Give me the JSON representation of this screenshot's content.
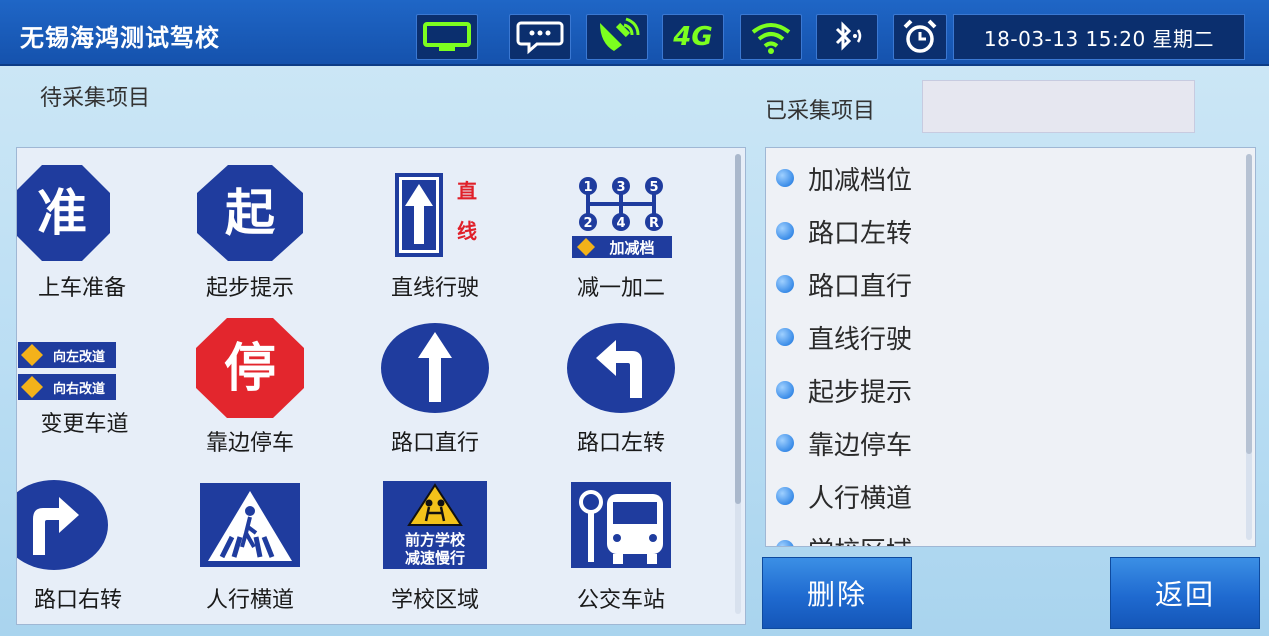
{
  "header": {
    "title": "无锡海鸿测试驾校",
    "datetime": "18-03-13 15:20 星期二",
    "status_icons": [
      "monitor-icon",
      "message-icon",
      "satellite-icon",
      "4g-icon",
      "wifi-icon",
      "bluetooth-icon",
      "alarm-clock-icon"
    ],
    "network_label": "4G"
  },
  "left": {
    "title": "待采集项目",
    "items": [
      {
        "label": "上车准备",
        "sign_text": "准",
        "icon": "prepare-octagon-icon"
      },
      {
        "label": "起步提示",
        "sign_text": "起",
        "icon": "start-octagon-icon"
      },
      {
        "label": "直线行驶",
        "sign_text_1": "直",
        "sign_text_2": "线",
        "icon": "straight-arrow-sign-icon"
      },
      {
        "label": "减一加二",
        "sign_text": "加减档",
        "gears": [
          "1",
          "3",
          "5",
          "2",
          "4",
          "R"
        ],
        "icon": "gear-shift-icon"
      },
      {
        "label": "变更车道",
        "sign_text_1": "向左改道",
        "sign_text_2": "向右改道",
        "icon": "lane-change-icon"
      },
      {
        "label": "靠边停车",
        "sign_text": "停",
        "icon": "stop-octagon-icon"
      },
      {
        "label": "路口直行",
        "icon": "straight-circle-icon"
      },
      {
        "label": "路口左转",
        "icon": "left-turn-circle-icon"
      },
      {
        "label": "路口右转",
        "icon": "right-turn-circle-icon"
      },
      {
        "label": "人行横道",
        "icon": "crosswalk-sign-icon"
      },
      {
        "label": "学校区域",
        "sign_text_1": "前方学校",
        "sign_text_2": "减速慢行",
        "icon": "school-zone-sign-icon"
      },
      {
        "label": "公交车站",
        "icon": "bus-stop-sign-icon"
      }
    ]
  },
  "right": {
    "title": "已采集项目",
    "items": [
      "加减档位",
      "路口左转",
      "路口直行",
      "直线行驶",
      "起步提示",
      "靠边停车",
      "人行横道",
      "学校区域"
    ]
  },
  "buttons": {
    "delete": "删除",
    "back": "返回"
  }
}
